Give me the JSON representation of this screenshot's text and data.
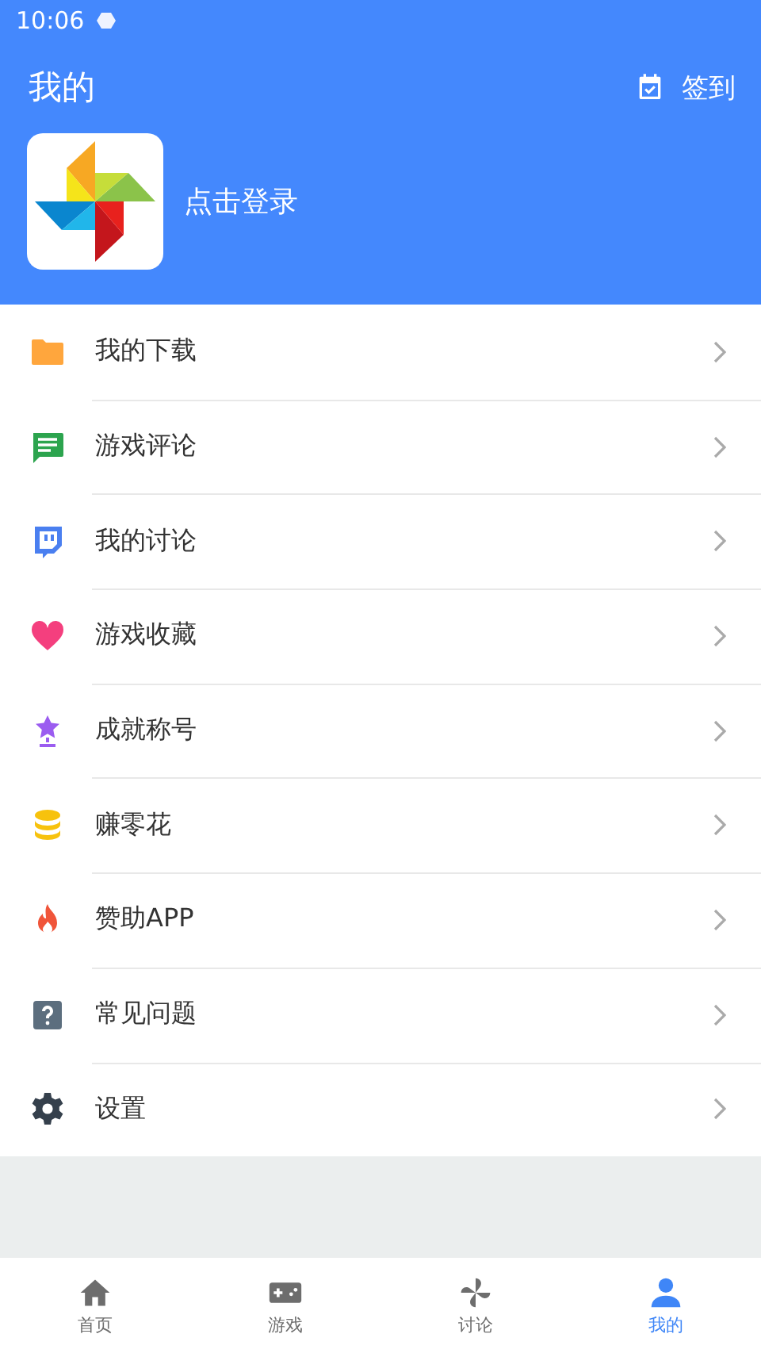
{
  "status_bar": {
    "time": "10:06"
  },
  "header": {
    "title": "我的",
    "checkin": "签到",
    "login": "点击登录"
  },
  "menu": [
    {
      "kind": "folder",
      "label": "我的下载"
    },
    {
      "kind": "chat",
      "label": "游戏评论"
    },
    {
      "kind": "discuss",
      "label": "我的讨论"
    },
    {
      "kind": "heart",
      "label": "游戏收藏"
    },
    {
      "kind": "trophy",
      "label": "成就称号"
    },
    {
      "kind": "coins",
      "label": "赚零花"
    },
    {
      "kind": "flame",
      "label": "赞助APP"
    },
    {
      "kind": "question",
      "label": "常见问题"
    },
    {
      "kind": "gear",
      "label": "设置"
    }
  ],
  "tabs": [
    {
      "kind": "home",
      "label": "首页",
      "selected": false
    },
    {
      "kind": "gamepad",
      "label": "游戏",
      "selected": false
    },
    {
      "kind": "pinwheel",
      "label": "讨论",
      "selected": false
    },
    {
      "kind": "person",
      "label": "我的",
      "selected": true
    }
  ]
}
